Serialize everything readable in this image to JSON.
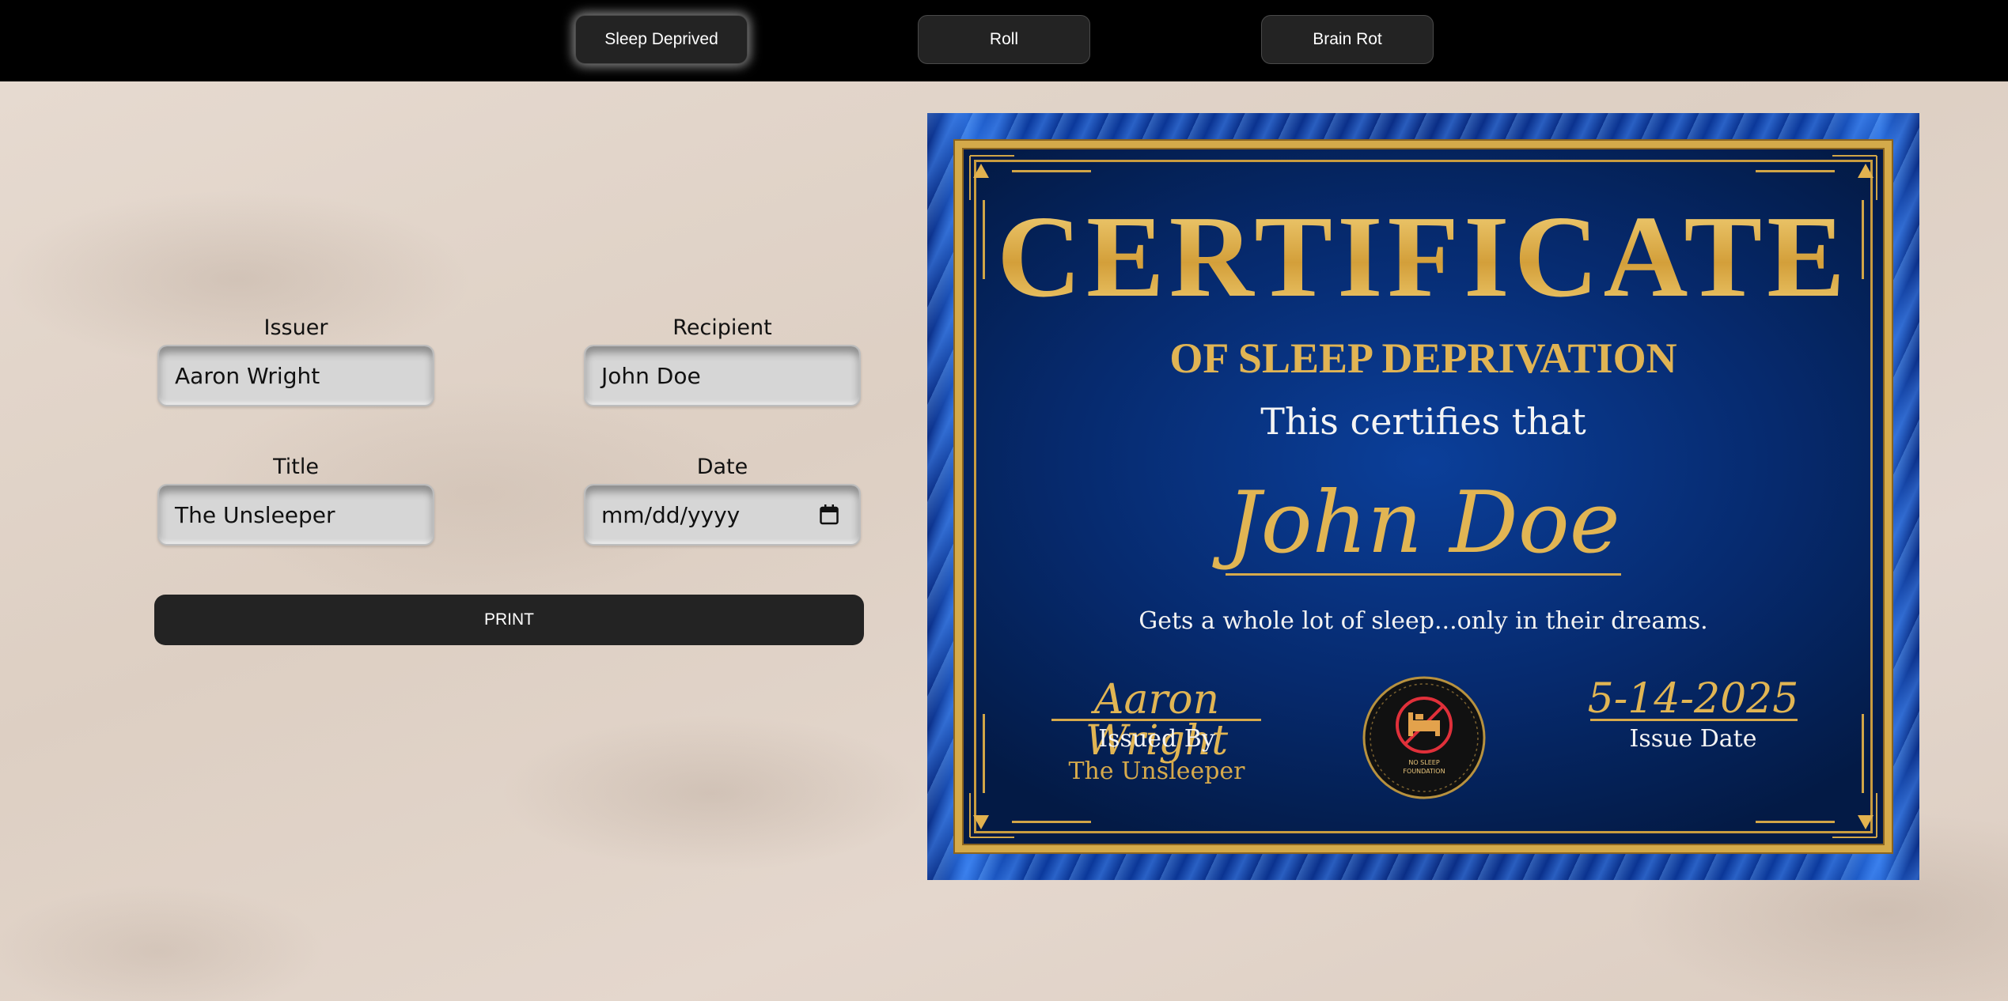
{
  "nav": {
    "tabs": [
      {
        "label": "Sleep Deprived",
        "active": true
      },
      {
        "label": "Roll",
        "active": false
      },
      {
        "label": "Brain Rot",
        "active": false
      }
    ]
  },
  "form": {
    "issuer": {
      "label": "Issuer",
      "value": "Aaron Wright"
    },
    "recipient": {
      "label": "Recipient",
      "value": "John Doe"
    },
    "title": {
      "label": "Title",
      "value": "The Unsleeper"
    },
    "date": {
      "label": "Date",
      "value": "mm/dd/yyyy"
    },
    "print_label": "PRINT"
  },
  "certificate": {
    "heading": "CERTIFICATE",
    "subheading": "OF SLEEP DEPRIVATION",
    "certifies": "This certifies that",
    "recipient_name": "John Doe",
    "description": "Gets a whole lot of sleep...only in their dreams.",
    "issuer_signature": "Aaron Wright",
    "issued_by_label": "Issued By",
    "issuer_title": "The Unsleeper",
    "issue_date": "5-14-2025",
    "issue_date_label": "Issue Date",
    "seal_text_line1": "NO SLEEP",
    "seal_text_line2": "FOUNDATION"
  },
  "colors": {
    "gold": "#d4aa4a",
    "navy": "#062a6e",
    "button_dark": "#232323"
  }
}
